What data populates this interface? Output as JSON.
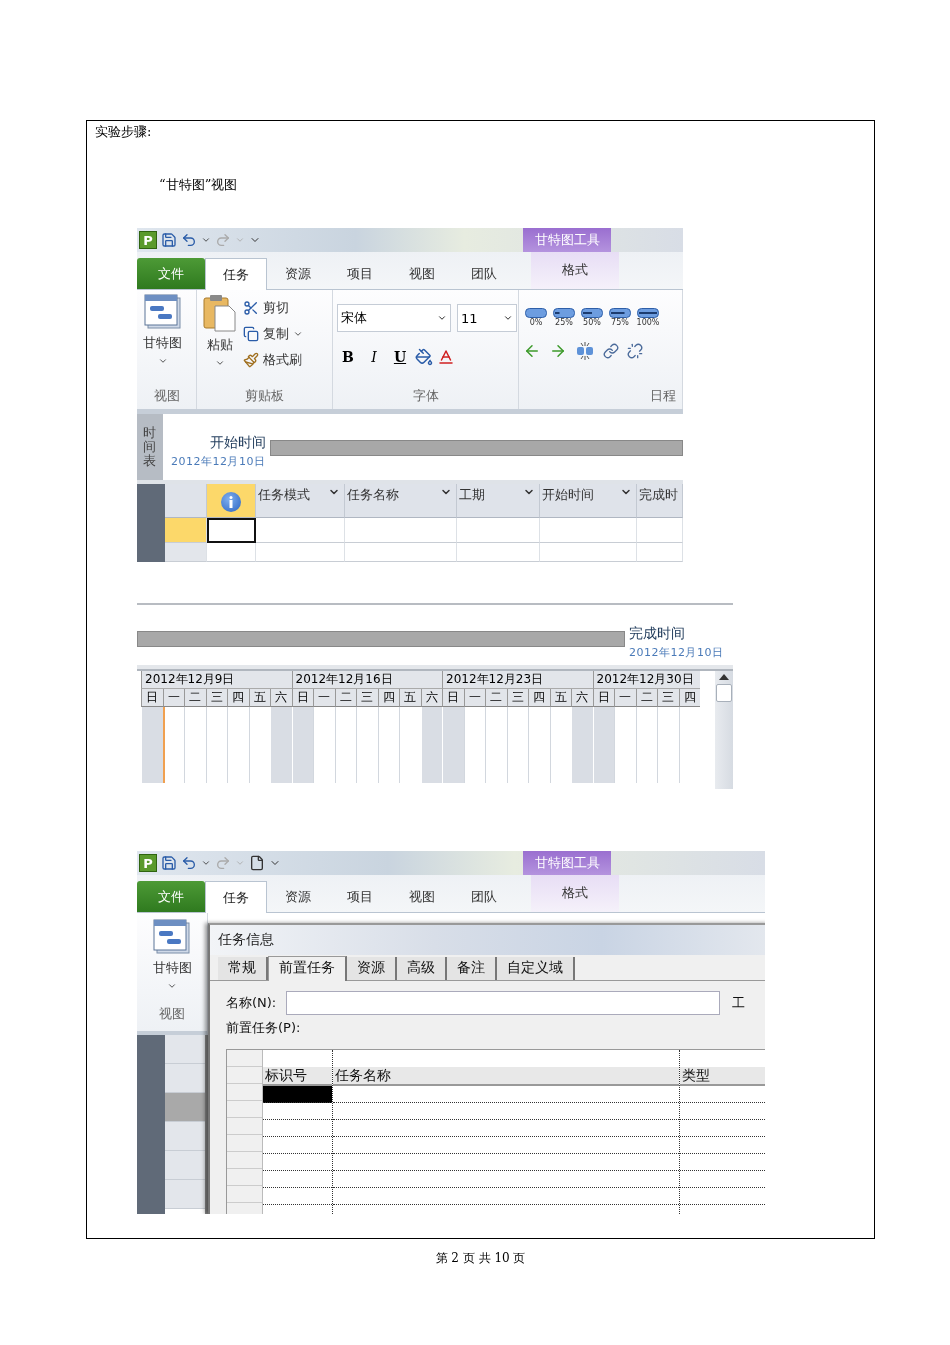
{
  "heading": "实验步骤:",
  "caption": "“甘特图”视图",
  "ribbon": {
    "logo": "P",
    "context_title": "甘特图工具",
    "tabs": [
      {
        "label": "文件",
        "kind": "file",
        "selected": false
      },
      {
        "label": "任务",
        "kind": "tab",
        "selected": true
      },
      {
        "label": "资源",
        "kind": "tab",
        "selected": false
      },
      {
        "label": "项目",
        "kind": "tab",
        "selected": false
      },
      {
        "label": "视图",
        "kind": "tab",
        "selected": false
      },
      {
        "label": "团队",
        "kind": "tab",
        "selected": false
      },
      {
        "label": "格式",
        "kind": "context",
        "selected": false
      }
    ],
    "view_group": {
      "button": "甘特图",
      "label": "视图"
    },
    "clipboard_group": {
      "paste": "粘贴",
      "cut": "剪切",
      "copy": "复制",
      "format_painter": "格式刷",
      "label": "剪贴板"
    },
    "font_group": {
      "font_name": "宋体",
      "font_size": "11",
      "bold": "B",
      "italic": "I",
      "underline": "U",
      "label": "字体"
    },
    "schedule_group": {
      "percents": [
        "0%",
        "25%",
        "50%",
        "75%",
        "100%"
      ],
      "label": "日程"
    }
  },
  "timeline": {
    "side_label": "时间表",
    "start_label": "开始时间",
    "start_date": "2012年12月10日"
  },
  "task_table": {
    "columns": [
      "任务模式",
      "任务名称",
      "工期",
      "开始时间",
      "完成时"
    ],
    "rows": [
      {
        "selected": true
      },
      {
        "selected": false
      }
    ]
  },
  "gantt": {
    "finish_label": "完成时间",
    "finish_date": "2012年12月10日",
    "weeks": [
      {
        "label": "2012年12月9日",
        "days": [
          {
            "label": "日",
            "weekend": true,
            "today": false
          },
          {
            "label": "一",
            "weekend": false,
            "today": true
          },
          {
            "label": "二",
            "weekend": false,
            "today": false
          },
          {
            "label": "三",
            "weekend": false,
            "today": false
          },
          {
            "label": "四",
            "weekend": false,
            "today": false
          },
          {
            "label": "五",
            "weekend": false,
            "today": false
          },
          {
            "label": "六",
            "weekend": true,
            "today": false
          }
        ]
      },
      {
        "label": "2012年12月16日",
        "days": [
          {
            "label": "日",
            "weekend": true,
            "today": false
          },
          {
            "label": "一",
            "weekend": false,
            "today": false
          },
          {
            "label": "二",
            "weekend": false,
            "today": false
          },
          {
            "label": "三",
            "weekend": false,
            "today": false
          },
          {
            "label": "四",
            "weekend": false,
            "today": false
          },
          {
            "label": "五",
            "weekend": false,
            "today": false
          },
          {
            "label": "六",
            "weekend": true,
            "today": false
          }
        ]
      },
      {
        "label": "2012年12月23日",
        "days": [
          {
            "label": "日",
            "weekend": true,
            "today": false
          },
          {
            "label": "一",
            "weekend": false,
            "today": false
          },
          {
            "label": "二",
            "weekend": false,
            "today": false
          },
          {
            "label": "三",
            "weekend": false,
            "today": false
          },
          {
            "label": "四",
            "weekend": false,
            "today": false
          },
          {
            "label": "五",
            "weekend": false,
            "today": false
          },
          {
            "label": "六",
            "weekend": true,
            "today": false
          }
        ]
      },
      {
        "label": "2012年12月30日",
        "days": [
          {
            "label": "日",
            "weekend": true,
            "today": false
          },
          {
            "label": "一",
            "weekend": false,
            "today": false
          },
          {
            "label": "二",
            "weekend": false,
            "today": false
          },
          {
            "label": "三",
            "weekend": false,
            "today": false
          },
          {
            "label": "四",
            "weekend": false,
            "today": false
          }
        ]
      }
    ]
  },
  "second_shot": {
    "ribbon": {
      "logo": "P",
      "context_title": "甘特图工具",
      "tabs": [
        {
          "label": "文件",
          "kind": "file",
          "selected": false
        },
        {
          "label": "任务",
          "kind": "tab",
          "selected": true
        },
        {
          "label": "资源",
          "kind": "tab",
          "selected": false
        },
        {
          "label": "项目",
          "kind": "tab",
          "selected": false
        },
        {
          "label": "视图",
          "kind": "tab",
          "selected": false
        },
        {
          "label": "团队",
          "kind": "tab",
          "selected": false
        },
        {
          "label": "格式",
          "kind": "context",
          "selected": false
        }
      ],
      "view_group": {
        "button": "甘特图",
        "label": "视图"
      }
    },
    "background_rows": [
      {
        "selected": false
      },
      {
        "selected": false
      },
      {
        "selected": true
      },
      {
        "selected": false
      },
      {
        "selected": false
      },
      {
        "selected": false
      }
    ],
    "dialog": {
      "title": "任务信息",
      "tabs": [
        {
          "label": "常规",
          "selected": false
        },
        {
          "label": "前置任务",
          "selected": true
        },
        {
          "label": "资源",
          "selected": false
        },
        {
          "label": "高级",
          "selected": false
        },
        {
          "label": "备注",
          "selected": false
        },
        {
          "label": "自定义域",
          "selected": false
        }
      ],
      "name_label": "名称(N):",
      "cut_label": "工",
      "predecessors_label": "前置任务(P):",
      "columns": [
        "标识号",
        "任务名称",
        "类型"
      ],
      "rows": [
        {
          "selected": true
        },
        {
          "selected": false
        },
        {
          "selected": false
        },
        {
          "selected": false
        },
        {
          "selected": false
        },
        {
          "selected": false
        },
        {
          "selected": false
        }
      ]
    }
  },
  "footer": "第 2 页 共 10 页"
}
